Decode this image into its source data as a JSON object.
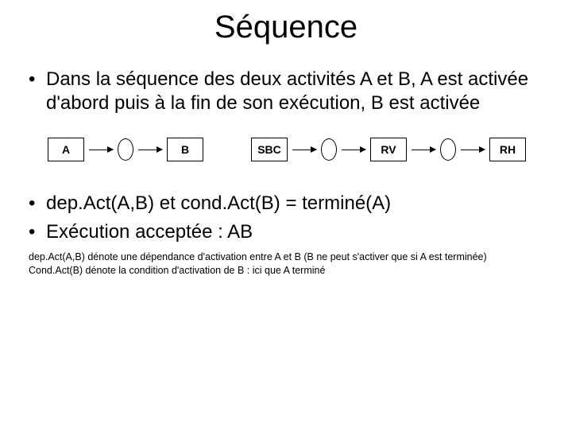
{
  "title": "Séquence",
  "bullet1": "Dans la séquence des deux activités A et B, A est activée d'abord puis à la fin de son exécution, B est activée",
  "bullet2": "dep.Act(A,B) et cond.Act(B) = terminé(A)",
  "bullet3": "Exécution acceptée : AB",
  "diagram": {
    "left": {
      "n1": "A",
      "n2": "B"
    },
    "right": {
      "n1": "SBC",
      "n2": "RV",
      "n3": "RH"
    }
  },
  "footnote_line1": "dep.Act(A,B) dénote une dépendance d'activation entre A et B (B ne peut s'activer que si A est terminée)",
  "footnote_line2": "Cond.Act(B) dénote la condition d'activation de B : ici que A terminé"
}
